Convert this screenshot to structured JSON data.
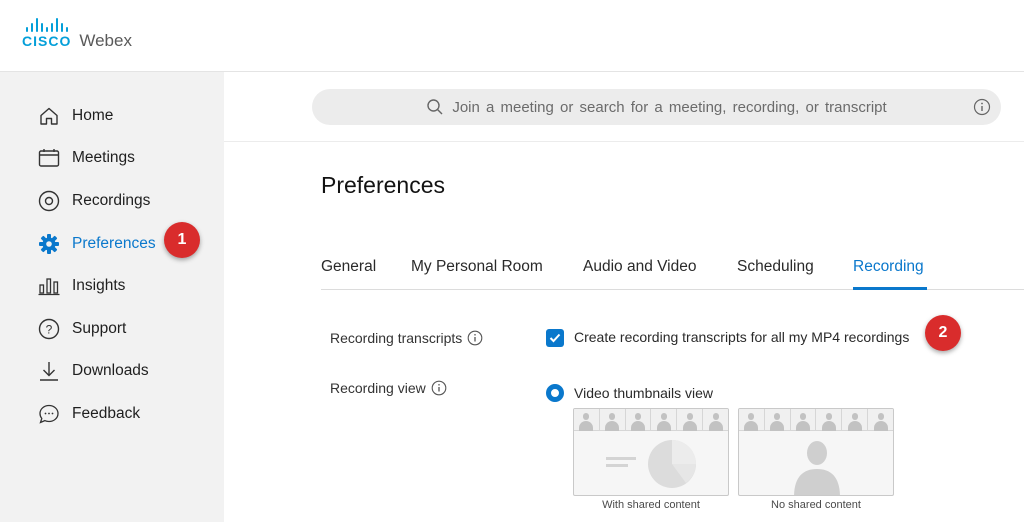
{
  "brand": {
    "cisco": "CISCO",
    "product": "Webex",
    "color": "#049fd9"
  },
  "sidebar": {
    "items": [
      {
        "label": "Home",
        "icon": "home-icon"
      },
      {
        "label": "Meetings",
        "icon": "calendar-icon"
      },
      {
        "label": "Recordings",
        "icon": "recording-icon"
      },
      {
        "label": "Preferences",
        "icon": "gear-icon",
        "active": true
      },
      {
        "label": "Insights",
        "icon": "bar-chart-icon"
      },
      {
        "label": "Support",
        "icon": "help-icon"
      },
      {
        "label": "Downloads",
        "icon": "download-icon"
      },
      {
        "label": "Feedback",
        "icon": "chat-icon"
      }
    ]
  },
  "search": {
    "placeholder": "Join a meeting or search for a meeting, recording, or transcript"
  },
  "page": {
    "title": "Preferences"
  },
  "tabs": [
    {
      "label": "General"
    },
    {
      "label": "My Personal Room"
    },
    {
      "label": "Audio and Video"
    },
    {
      "label": "Scheduling"
    },
    {
      "label": "Recording",
      "active": true
    }
  ],
  "recording": {
    "transcripts_label": "Recording transcripts",
    "transcripts_option": "Create recording transcripts for all my MP4 recordings",
    "transcripts_checked": true,
    "view_label": "Recording view",
    "view_option": "Video thumbnails view",
    "view_selected": true,
    "thumb_shared": "With shared content",
    "thumb_no_shared": "No shared content"
  },
  "annotations": {
    "step1": "1",
    "step2": "2",
    "color": "#d92c2c"
  },
  "colors": {
    "accent": "#0a78cc",
    "sidebar_bg": "#f2f2f2"
  }
}
